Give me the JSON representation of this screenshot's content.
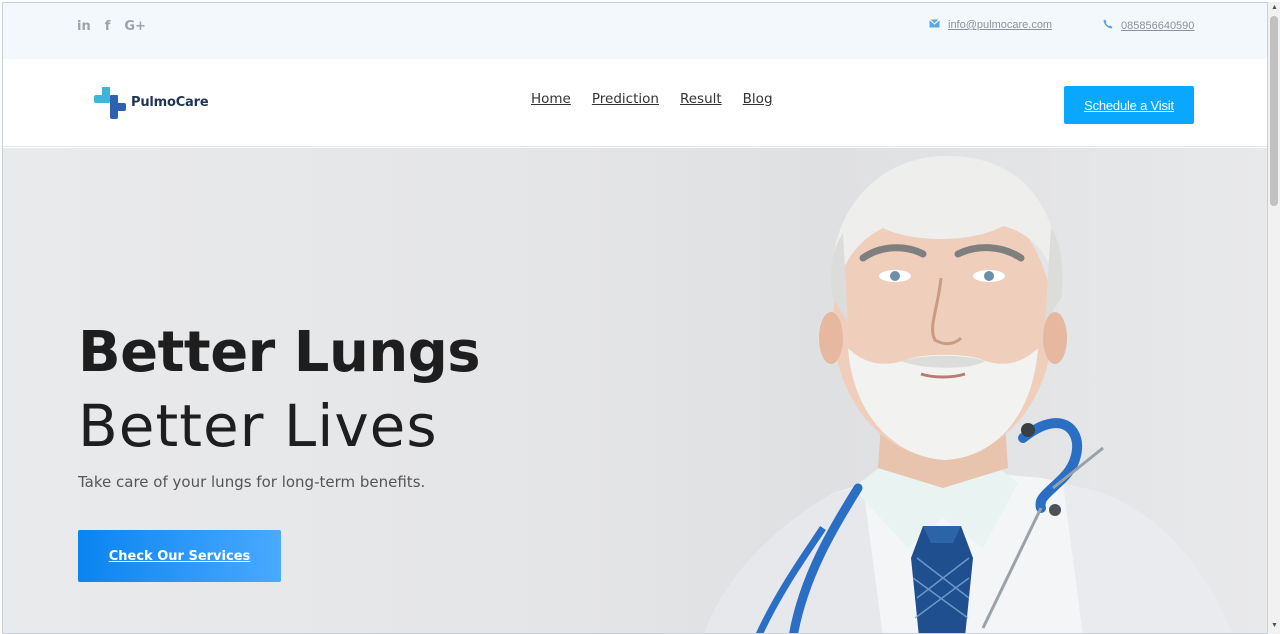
{
  "topbar": {
    "social": [
      {
        "icon": "linkedin-icon",
        "glyph": "in"
      },
      {
        "icon": "facebook-icon",
        "glyph": "f"
      },
      {
        "icon": "google-plus-icon",
        "glyph": "G+"
      }
    ],
    "email": " info@pulmocare.com",
    "phone": " 085856640590"
  },
  "header": {
    "logo_text": "PulmoCare",
    "nav": [
      "Home",
      "Prediction",
      "Result",
      "Blog"
    ],
    "cta_label": "Schedule a Visit"
  },
  "hero": {
    "title_bold": "Better Lungs",
    "title_light": "Better Lives",
    "subtitle": "Take care of your lungs for long-term benefits.",
    "button_label": "Check Our Services"
  },
  "colors": {
    "accent": "#0aa7ff",
    "button_gradient_start": "#0a84f0",
    "button_gradient_end": "#4aa9ff",
    "topbar_bg": "#f3f8fd",
    "logo_navy": "#1f3552"
  }
}
